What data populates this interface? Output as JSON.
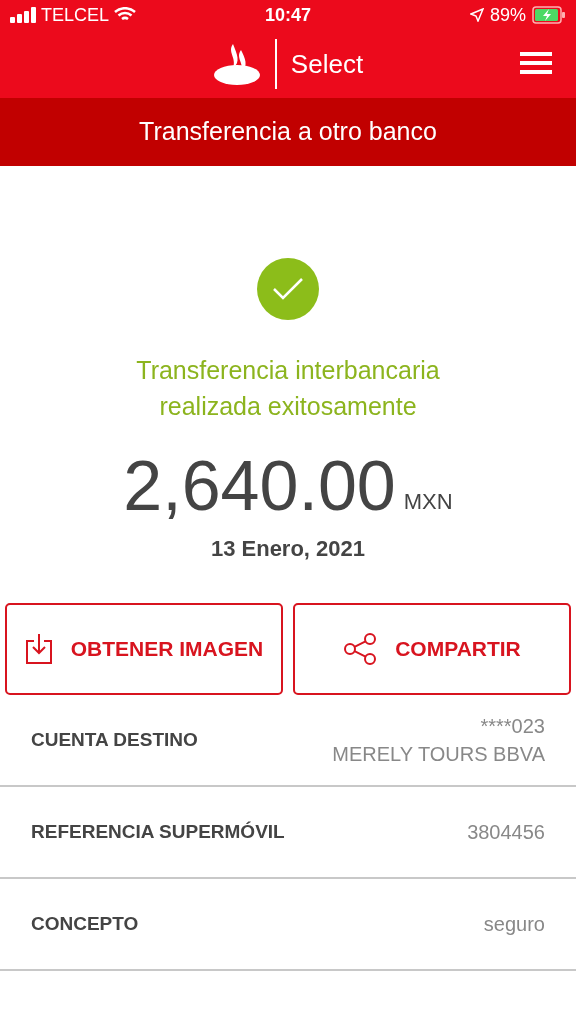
{
  "status_bar": {
    "carrier": "TELCEL",
    "time": "10:47",
    "battery": "89%"
  },
  "header": {
    "brand": "Select"
  },
  "title": "Transferencia a otro banco",
  "result": {
    "message": "Transferencia interbancaria realizada exitosamente",
    "amount": "2,640.00",
    "currency": "MXN",
    "date": "13 Enero, 2021"
  },
  "actions": [
    {
      "kind": "download",
      "label": "OBTENER IMAGEN"
    },
    {
      "kind": "share",
      "label": "COMPARTIR"
    }
  ],
  "details": [
    {
      "label": "CUENTA DESTINO",
      "values": [
        "****023",
        "MERELY TOURS BBVA"
      ]
    },
    {
      "label": "REFERENCIA SUPERMÓVIL",
      "values": [
        "3804456"
      ]
    },
    {
      "label": "CONCEPTO",
      "values": [
        "seguro"
      ]
    }
  ]
}
